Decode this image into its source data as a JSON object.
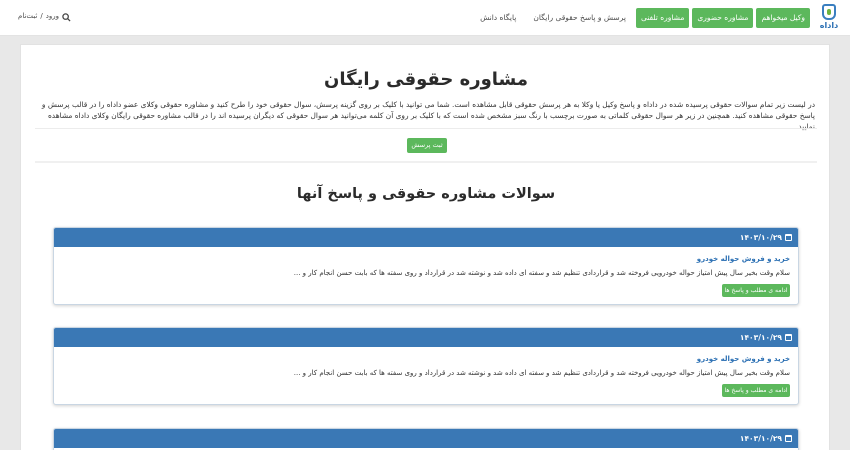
{
  "header": {
    "logo_text": "داداه",
    "nav": [
      {
        "label": "وکیل میخواهم"
      },
      {
        "label": "مشاوره حضوری"
      },
      {
        "label": "مشاوره تلفنی"
      },
      {
        "label": "پرسش و پاسخ حقوقی رایگان"
      },
      {
        "label": "پایگاه دانش"
      }
    ],
    "login_label": "ورود",
    "separator": "/",
    "signup_label": "ثبت‌نام",
    "search_icon": "search-icon"
  },
  "main": {
    "title": "مشاوره حقوقی رایگان",
    "intro": "در لیست زیر تمام سوالات حقوقی پرسیده شده در داداه و پاسخ وکیل یا وکلا به هر پرسش حقوقی قابل مشاهده است. شما می توانید با کلیک بر روی گزینه پرسش، سوال حقوقی خود را طرح کنید و مشاوره حقوقی وکلای عضو داداه را در قالب پرسش و پاسخ حقوقی مشاهده کنید. همچنین در زیر هر سوال حقوقی کلماتی به صورت برچسب با رنگ سبز مشخص شده است که با کلیک بر روی آن کلمه می‌توانید هر سوال حقوقی که دیگران پرسیده اند را در قالب مشاوره حقوقی رایگان وکلای داداه مشاهده نمایید.",
    "ask_button": "ثبت پرسش",
    "section_title": "سوالات مشاوره حقوقی و پاسخ آنها"
  },
  "questions": [
    {
      "date": "۱۴۰۳/۱۰/۲۹",
      "title": "خرید و فروش حواله خودرو",
      "snippet": "سلام وقت بخیر سال پیش امتیاز حواله خودرویی فروخته شد و قراردادی تنظیم شد و سفته ای داده شد و نوشته شد در قرارداد و روی سفته ها که بابت حسن انجام کار و ...",
      "button": "ادامه ی مطلب و پاسخ ها ..."
    },
    {
      "date": "۱۴۰۳/۱۰/۲۹",
      "title": "خرید و فروش حواله خودرو",
      "snippet": "سلام وقت بخیر سال پیش امتیاز حواله خودرویی فروخته شد و قراردادی تنظیم شد و سفته ای داده شد و نوشته شد در قرارداد و روی سفته ها که بابت حسن انجام کار و ...",
      "button": "ادامه ی مطلب و پاسخ ها ..."
    },
    {
      "date": "۱۴۰۳/۱۰/۲۹"
    }
  ],
  "colors": {
    "accent_green": "#5cb85c",
    "header_blue": "#3a78b5",
    "link_blue": "#2a6fb3"
  }
}
